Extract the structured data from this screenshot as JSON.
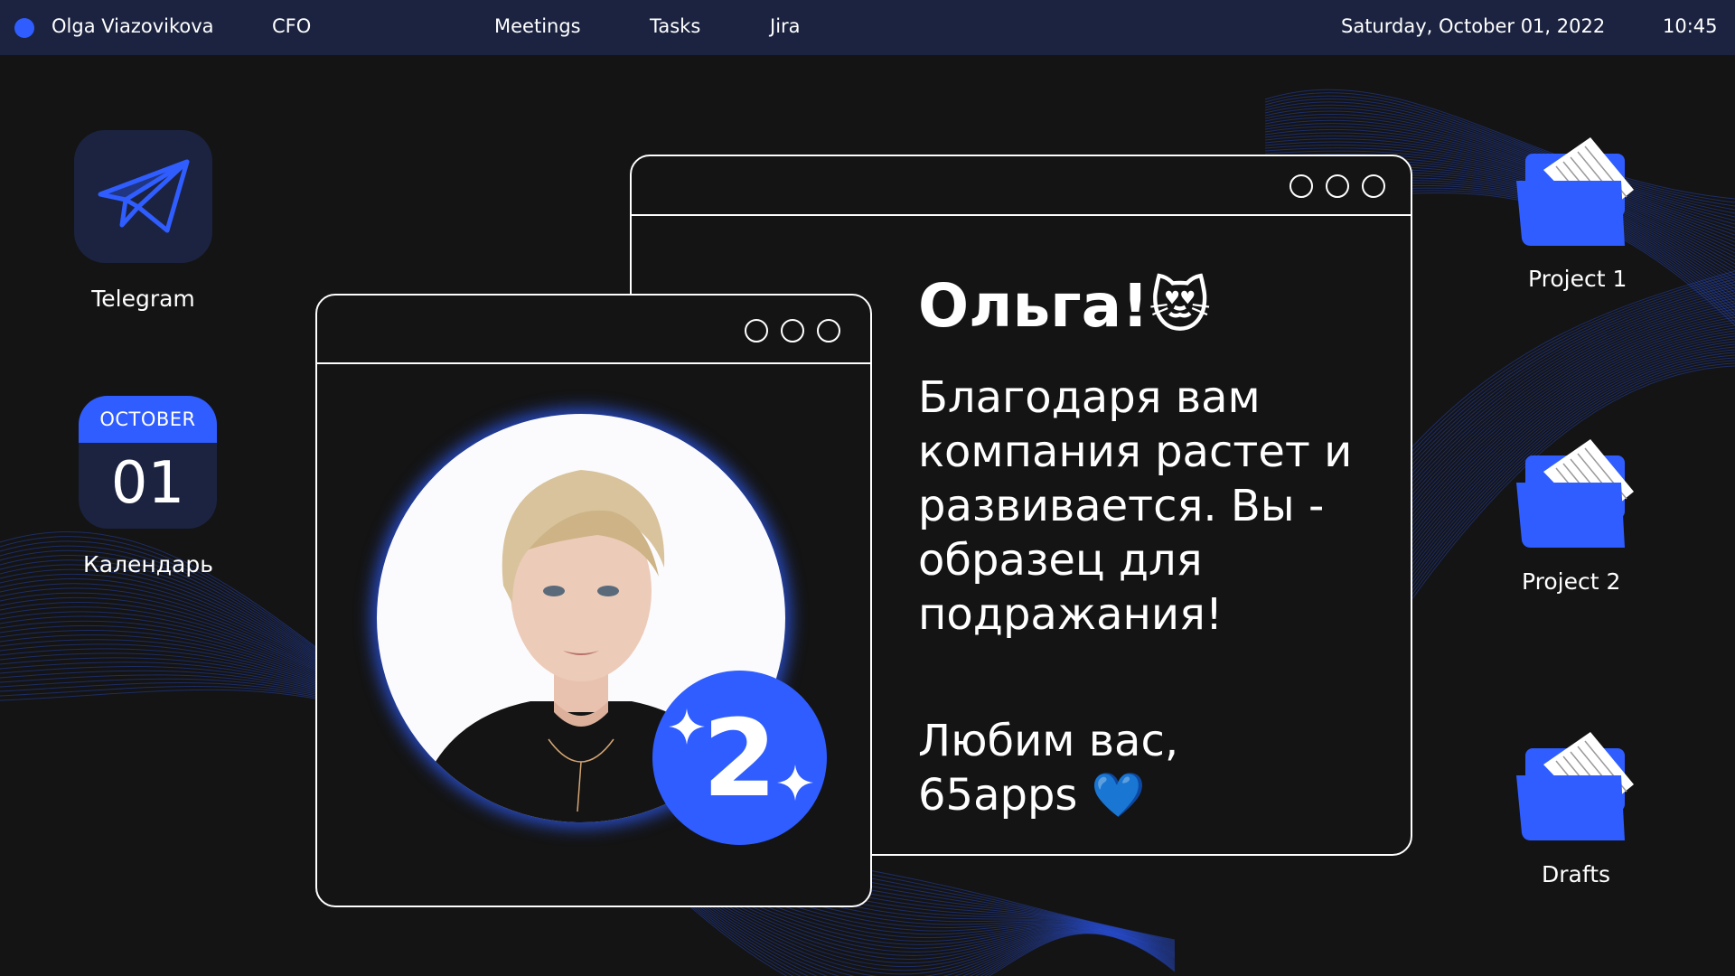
{
  "topbar": {
    "user_name": "Olga Viazovikova",
    "role": "CFO",
    "nav": [
      "Meetings",
      "Tasks",
      "Jira"
    ],
    "date": "Saturday, October 01,  2022",
    "time": "10:45"
  },
  "desktop": {
    "telegram": {
      "label": "Telegram",
      "icon": "paper-plane-icon"
    },
    "calendar": {
      "month": "OCTOBER",
      "day": "01",
      "label": "Календарь"
    },
    "folders": [
      "Project 1",
      "Project 2",
      "Drafts"
    ]
  },
  "message_window": {
    "greeting": "Ольга!😻",
    "message": "Благодаря вам компания растет и развивается. Вы - образец для подражания!",
    "signature_line1": "Любим вас,",
    "signature_line2": "65apps 💙"
  },
  "photo_window": {
    "badge_number": "2"
  },
  "colors": {
    "background": "#141414",
    "topbar": "#1b2340",
    "accent": "#2f5dff",
    "text": "#ffffff"
  }
}
